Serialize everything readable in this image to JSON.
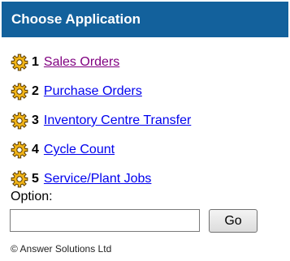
{
  "header": {
    "title": "Choose Application"
  },
  "menu": {
    "items": [
      {
        "number": "1",
        "label": "Sales Orders",
        "icon": "gear-icon",
        "link_color": "#800080"
      },
      {
        "number": "2",
        "label": "Purchase Orders",
        "icon": "gear-icon",
        "link_color": "#0000ee"
      },
      {
        "number": "3",
        "label": "Inventory Centre Transfer",
        "icon": "gear-icon",
        "link_color": "#0000ee"
      },
      {
        "number": "4",
        "label": "Cycle Count",
        "icon": "gear-icon",
        "link_color": "#0000ee"
      },
      {
        "number": "5",
        "label": "Service/Plant Jobs",
        "icon": "gear-icon",
        "link_color": "#0000ee"
      }
    ]
  },
  "option": {
    "label": "Option:",
    "value": "",
    "button_label": "Go"
  },
  "footer": {
    "copyright": "© Answer Solutions Ltd"
  },
  "colors": {
    "header_bg": "#13619c",
    "header_text": "#ffffff",
    "gear_fill": "#f0b418",
    "gear_outline": "#5a3a00",
    "visited_link": "#800080",
    "link": "#0000ee"
  }
}
